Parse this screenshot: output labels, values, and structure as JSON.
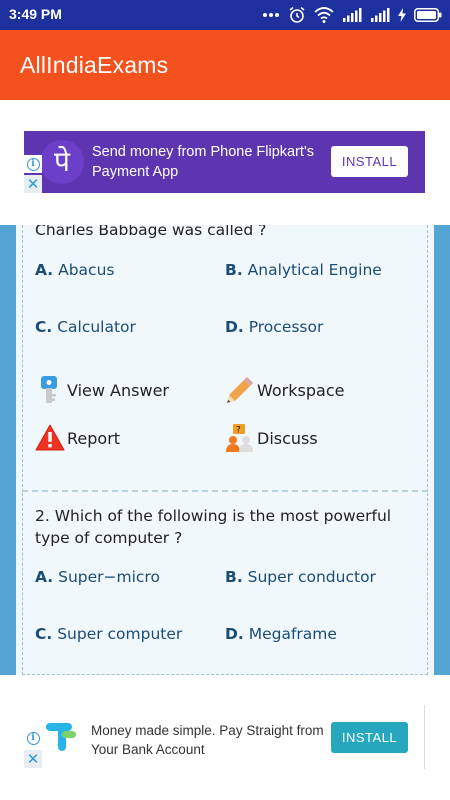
{
  "status_bar": {
    "time": "3:49 PM",
    "icons": [
      "dots-icon",
      "alarm-icon",
      "wifi-icon",
      "signal-icon",
      "signal-icon",
      "charging-icon",
      "battery-icon"
    ]
  },
  "app_bar": {
    "title": "AllIndiaExams"
  },
  "top_ad": {
    "logo_glyph": "पे",
    "text": "Send money from Phone Flipkart's Payment App",
    "button": "INSTALL",
    "info_glyph": "i",
    "close_glyph": "✕"
  },
  "questions": [
    {
      "text": "Charles Babbage was called ?",
      "options": [
        {
          "letter": "A.",
          "label": "Abacus"
        },
        {
          "letter": "B.",
          "label": "Analytical Engine"
        },
        {
          "letter": "C.",
          "label": "Calculator"
        },
        {
          "letter": "D.",
          "label": "Processor"
        }
      ],
      "actions": {
        "view_answer": "View Answer",
        "workspace": "Workspace",
        "report": "Report",
        "discuss": "Discuss"
      }
    },
    {
      "text": "2. Which of the following is the most powerful type of computer ?",
      "options": [
        {
          "letter": "A.",
          "label": "Super−micro"
        },
        {
          "letter": "B.",
          "label": "Super conductor"
        },
        {
          "letter": "C.",
          "label": "Super computer"
        },
        {
          "letter": "D.",
          "label": "Megaframe"
        }
      ]
    }
  ],
  "bottom_ad": {
    "text": "Money made simple. Pay Straight from Your Bank Account",
    "button": "INSTALL",
    "info_glyph": "i",
    "close_glyph": "✕"
  },
  "colors": {
    "status_bar": "#1e2f9e",
    "app_bar": "#f4511e",
    "page_bg": "#55a5d4",
    "card_bg": "#f1f8fb",
    "option_text": "#1b4c78",
    "phonepe_ad": "#5e35b1",
    "install_button_teal": "#26a7bd"
  }
}
